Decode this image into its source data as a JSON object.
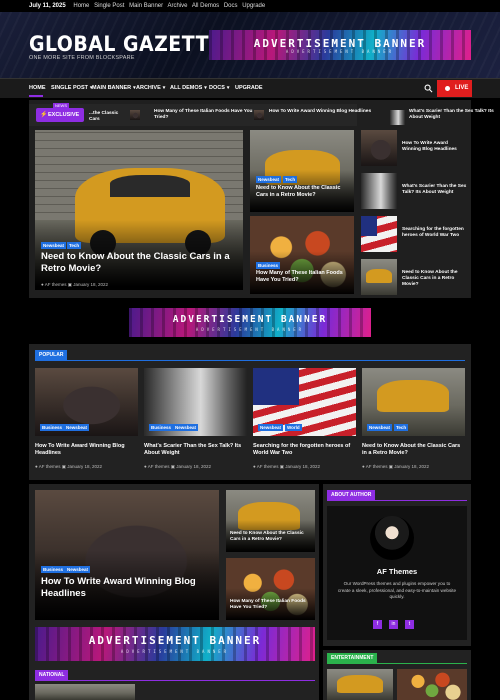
{
  "topbar": {
    "date": "July 11, 2025",
    "links": [
      "Home",
      "Single Post",
      "Main Banner",
      "Archive",
      "All Demos",
      "Docs",
      "Upgrade"
    ]
  },
  "header": {
    "site_title": "GLOBAL GAZETTE",
    "tagline": "ONE MORE SITE FROM BLOCKSPARE",
    "ad": {
      "title": "ADVERTISEMENT BANNER",
      "sub": "ADVERTISEMENT BANNER"
    }
  },
  "nav": {
    "items": [
      "HOME",
      "SINGLE POST",
      "MAIN BANNER",
      "ARCHIVE",
      "ALL DEMOS",
      "DOCS",
      "UPGRADE"
    ],
    "live_label": "LIVE"
  },
  "exclusive": {
    "badge": "EXCLUSIVE",
    "news_label": "NEWS",
    "ticker": [
      "...the Classic Cars",
      "How Many of These Italian Foods Have You Tried?",
      "How To Write Award Winning Blog Headlines",
      "What's Scarier Than the Sex Talk? Its About Weight"
    ]
  },
  "main_story": {
    "tags": [
      "Newsbeat",
      "Tech"
    ],
    "title": "Need to Know About the Classic Cars in a Retro Movie?",
    "author": "AF themes",
    "date": "January 18, 2022"
  },
  "mid_stories": [
    {
      "tags": [
        "Newsbeat",
        "Tech"
      ],
      "title": "Need to Know About the Classic Cars in a Retro Movie?"
    },
    {
      "tags": [
        "Business"
      ],
      "title": "How Many of These Italian Foods Have You Tried?"
    }
  ],
  "side_list": [
    "How To Write Award Winning Blog Headlines",
    "What's Scarier Than the Sex Talk? Its About Weight",
    "Searching for the forgotten heroes of World War Two",
    "Need to Know About the Classic Cars in a Retro Movie?"
  ],
  "mid_ad": {
    "title": "ADVERTISEMENT BANNER",
    "sub": "ADVERTISEMENT BANNER"
  },
  "popular": {
    "label": "POPULAR",
    "cards": [
      {
        "tags": [
          "Business",
          "Newsbeat"
        ],
        "title": "How To Write Award Winning Blog Headlines",
        "author": "AF themes",
        "date": "January 18, 2022"
      },
      {
        "tags": [
          "Business",
          "Newsbeat"
        ],
        "title": "What's Scarier Than the Sex Talk? Its About Weight",
        "author": "AF themes",
        "date": "January 18, 2022"
      },
      {
        "tags": [
          "Newsbeat",
          "World"
        ],
        "title": "Searching for the forgotten heroes of World War Two",
        "author": "AF themes",
        "date": "January 18, 2022"
      },
      {
        "tags": [
          "Newsbeat",
          "Tech"
        ],
        "title": "Need to Know About the Classic Cars in a Retro Movie?",
        "author": "AF themes",
        "date": "January 18, 2022"
      }
    ]
  },
  "lower": {
    "main": {
      "tags": [
        "Business",
        "Newsbeat"
      ],
      "title": "How To Write Award Winning Blog Headlines"
    },
    "small": [
      "Need to Know About the Classic Cars in a Retro Movie?",
      "How Many of These Italian Foods Have You Tried?"
    ],
    "ad": {
      "title": "ADVERTISEMENT BANNER",
      "sub": "ADVERTISEMENT BANNER"
    },
    "national_label": "NATIONAL"
  },
  "about": {
    "label": "ABOUT AUTHOR",
    "name": "AF Themes",
    "bio": "Our WordPress themes and plugins empower you to create a sleek, professional, and easy-to-maintain website quickly.",
    "social": [
      "f",
      "in",
      "t"
    ]
  },
  "entertainment": {
    "label": "ENTERTAINMENT"
  },
  "colors": {
    "accent": "#8e2de2",
    "live": "#e01e1e",
    "tag_blue": "#1f6fe0",
    "green": "#2bb24c"
  }
}
